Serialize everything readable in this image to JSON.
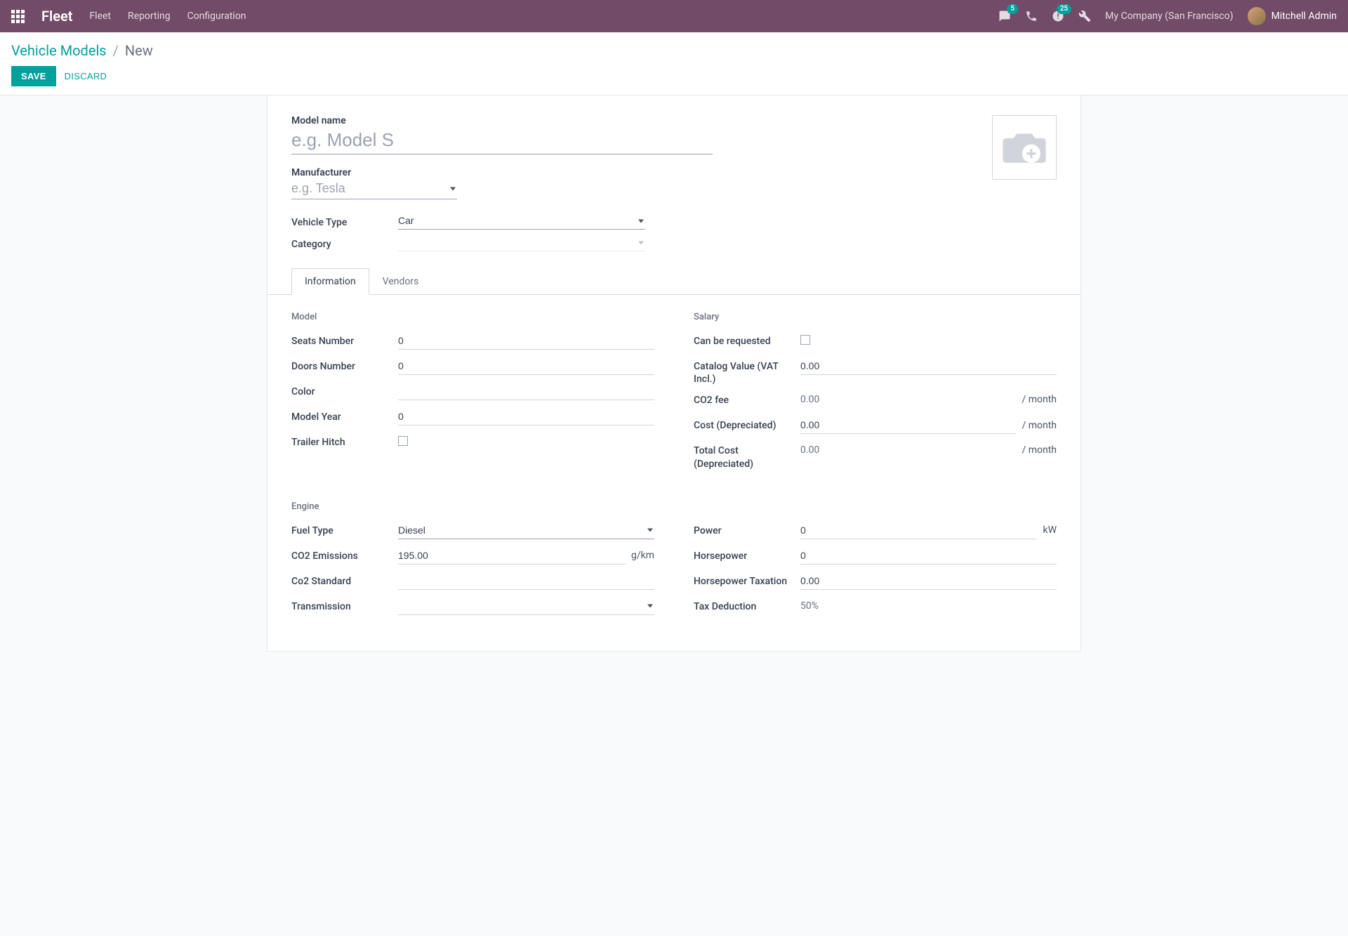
{
  "navbar": {
    "brand": "Fleet",
    "links": [
      "Fleet",
      "Reporting",
      "Configuration"
    ],
    "messages_badge": "5",
    "activities_badge": "25",
    "company": "My Company (San Francisco)",
    "user": "Mitchell Admin"
  },
  "breadcrumb": {
    "parent": "Vehicle Models",
    "current": "New"
  },
  "actions": {
    "save": "SAVE",
    "discard": "DISCARD"
  },
  "header_fields": {
    "model_name_label": "Model name",
    "model_name_placeholder": "e.g. Model S",
    "manufacturer_label": "Manufacturer",
    "manufacturer_placeholder": "e.g. Tesla",
    "vehicle_type_label": "Vehicle Type",
    "vehicle_type_value": "Car",
    "category_label": "Category",
    "category_value": ""
  },
  "tabs": {
    "information": "Information",
    "vendors": "Vendors"
  },
  "sections": {
    "model": {
      "title": "Model",
      "seats_label": "Seats Number",
      "seats_value": "0",
      "doors_label": "Doors Number",
      "doors_value": "0",
      "color_label": "Color",
      "color_value": "",
      "year_label": "Model Year",
      "year_value": "0",
      "trailer_label": "Trailer Hitch"
    },
    "salary": {
      "title": "Salary",
      "requested_label": "Can be requested",
      "catalog_label": "Catalog Value (VAT Incl.)",
      "catalog_value": "0.00",
      "co2fee_label": "CO2 fee",
      "co2fee_value": "0.00",
      "cost_dep_label": "Cost (Depreciated)",
      "cost_dep_value": "0.00",
      "total_cost_label": "Total Cost (Depreciated)",
      "total_cost_value": "0.00",
      "per_month": "/ month"
    },
    "engine": {
      "title": "Engine",
      "fuel_label": "Fuel Type",
      "fuel_value": "Diesel",
      "co2_label": "CO2 Emissions",
      "co2_value": "195.00",
      "co2_unit": "g/km",
      "co2std_label": "Co2 Standard",
      "co2std_value": "",
      "trans_label": "Transmission",
      "trans_value": ""
    },
    "engine_right": {
      "power_label": "Power",
      "power_value": "0",
      "power_unit": "kW",
      "hp_label": "Horsepower",
      "hp_value": "0",
      "hptax_label": "Horsepower Taxation",
      "hptax_value": "0.00",
      "taxded_label": "Tax Deduction",
      "taxded_value": "50%"
    }
  }
}
